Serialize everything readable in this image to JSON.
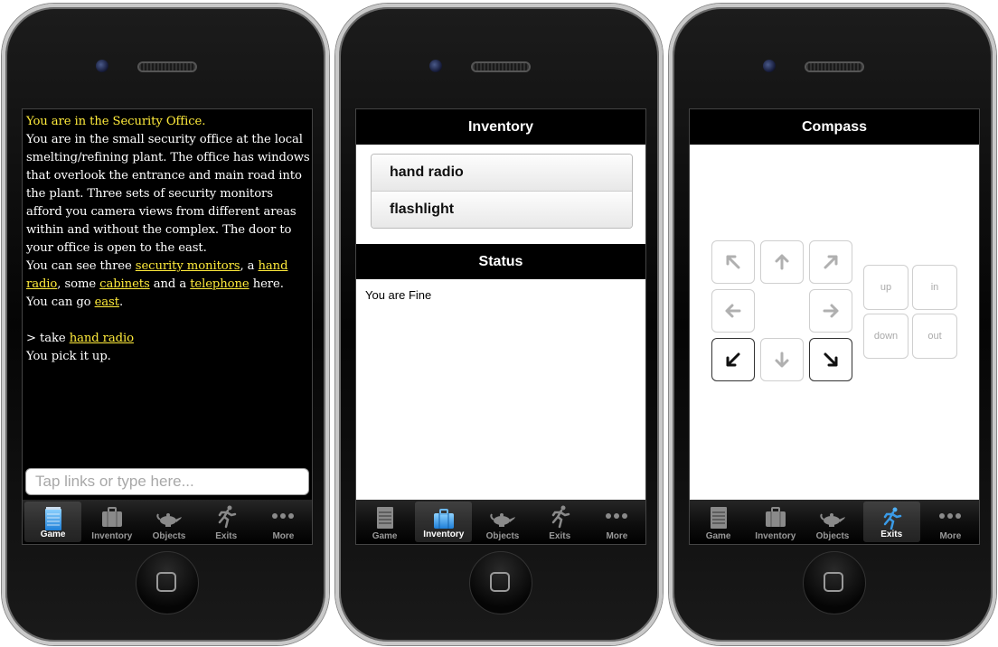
{
  "game": {
    "room_title": "You are in the Security Office.",
    "desc": "You are in the small security office at the local smelting/refining plant. The office has windows that overlook the entrance and main road into the plant. Three sets of security monitors afford you camera views from different areas within and without the complex. The door to your office is open to the east.",
    "see_prefix": "You can see three ",
    "link_monitors": "security monitors",
    "sep1": ", a ",
    "link_radio": "hand radio",
    "sep2": ", some ",
    "link_cabinets": "cabinets",
    "sep3": " and a ",
    "link_telephone": "telephone",
    "see_suffix": " here.",
    "go_prefix": "You can go ",
    "link_east": "east",
    "go_suffix": ".",
    "cmd_prefix": "> take ",
    "link_radio2": "hand radio",
    "result": "You pick it up.",
    "input_placeholder": "Tap links or type here..."
  },
  "tabs": [
    {
      "label": "Game"
    },
    {
      "label": "Inventory"
    },
    {
      "label": "Objects"
    },
    {
      "label": "Exits"
    },
    {
      "label": "More"
    }
  ],
  "inventory": {
    "title": "Inventory",
    "items": [
      "hand radio",
      "flashlight"
    ],
    "status_title": "Status",
    "status_text": "You are Fine"
  },
  "compass": {
    "title": "Compass",
    "up": "up",
    "in": "in",
    "down": "down",
    "out": "out"
  },
  "colors": {
    "link_yellow": "#ffeb3b",
    "active_blue": "#3a9be8"
  }
}
